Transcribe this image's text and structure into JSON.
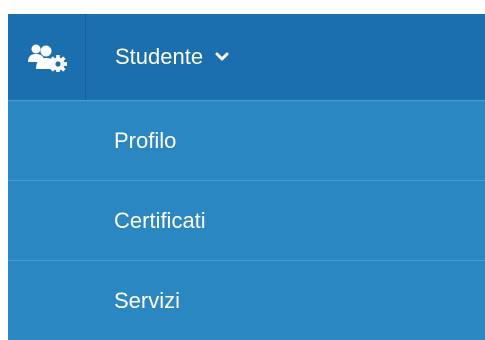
{
  "menu": {
    "header": {
      "icon": "users-gear-icon",
      "label": "Studente",
      "chevron_icon": "chevron-down-icon"
    },
    "items": [
      {
        "label": "Profilo"
      },
      {
        "label": "Certificati"
      },
      {
        "label": "Servizi"
      }
    ]
  },
  "colors": {
    "header_bg": "#1b6fae",
    "menu_bg": "#2b87c2",
    "divider": "#4a9bd0",
    "text": "#ffffff"
  }
}
